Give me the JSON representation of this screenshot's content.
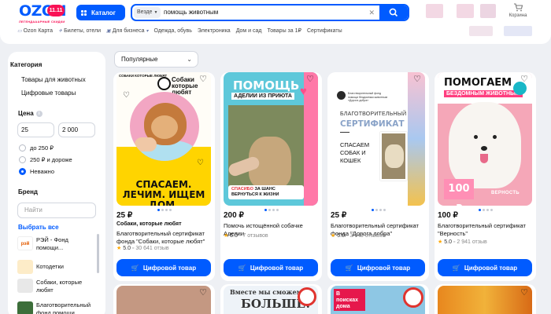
{
  "header": {
    "logo": "OZON",
    "logo_badge": "11.11",
    "logo_slogan": "ЛЕГЕНДАААРНЫЕ СКИДКИ",
    "catalog_label": "Каталог",
    "search_scope": "Везде",
    "search_value": "помощь животным",
    "cart_label": "Корзина",
    "icons": [
      "grid-icon",
      "search-icon",
      "clear-icon",
      "cart-icon"
    ],
    "subnav": [
      "Ozon Карта",
      "Билеты, отели",
      "Для бизнеса",
      "Одежда, обувь",
      "Электроника",
      "Дом и сад",
      "Товары за 1₽",
      "Сертификаты"
    ]
  },
  "sidebar": {
    "category_heading": "Категория",
    "categories": [
      "Товары для животных",
      "Цифровые товары"
    ],
    "price_heading": "Цена",
    "price_from": "25",
    "price_to": "2 000",
    "price_options": [
      "до 250 ₽",
      "250 ₽ и дороже",
      "Неважно"
    ],
    "price_selected": "Неважно",
    "brand_heading": "Бренд",
    "brand_placeholder": "Найти",
    "select_all": "Выбрать все",
    "brands": [
      {
        "name": "РЭЙ - Фонд помощи...",
        "logo": "рэй"
      },
      {
        "name": "Котодетки",
        "logo": ""
      },
      {
        "name": "Собаки, которые любят",
        "logo": ""
      },
      {
        "name": "Благотворительный фонд помощи",
        "logo": ""
      }
    ]
  },
  "sort": {
    "value": "Популярные"
  },
  "products": [
    {
      "price": "25 ₽",
      "seller": "Собаки, которые любят",
      "title": "Благотворительный сертификат фонда \"Собаки, которые любят\"",
      "rating": "5.0",
      "reviews": "30 641 отзыв",
      "button": "Цифровой товар",
      "image": {
        "logo_small": "СОБАКИ КОТОРЫЕ ЛЮБЯТ",
        "logo_right": "Собаки которые любят",
        "slogan": "СПАСАЕМ. ЛЕЧИМ. ИЩЕМ ДОМ."
      }
    },
    {
      "price": "200 ₽",
      "seller": "",
      "title": "Помочь истощённой собачке Аделии",
      "rating": "5.0",
      "reviews": "7 отзывов",
      "button": "Цифровой товар",
      "image": {
        "h1": "ПОМОЩЬ",
        "h2": "АДЕЛИИ ИЗ ПРИЮТА",
        "banner_strong": "СПАСИБО",
        "banner_rest": "ЗА ШАНС ВЕРНУТЬСЯ К ЖИЗНИ"
      }
    },
    {
      "price": "25 ₽",
      "seller": "",
      "title": "Благотворительный сертификат фонда \"Дорога добра\"",
      "rating": "5.0",
      "reviews": "3 649 отзывов",
      "button": "Цифровой товар",
      "image": {
        "logo_text": "Благотворительный фонд помощи бездомным животным «Дорога добра»",
        "cert_top": "БЛАГОТВОРИТЕЛЬНЫЙ",
        "cert": "СЕРТИФИКАТ",
        "save": "СПАСАЕМ СОБАК И КОШЕК"
      }
    },
    {
      "price": "100 ₽",
      "seller": "",
      "title": "Благотворительный сертификат \"Верность\"",
      "rating": "5.0",
      "reviews": "2 941 отзыв",
      "button": "Цифровой товар",
      "image": {
        "h1": "ПОМОГАЕМ",
        "h2": "БЕЗДОМНЫМ ЖИВОТНЫМ",
        "price_tag": "100 ₽",
        "brand": "ВЕРНОСТЬ"
      }
    }
  ],
  "bottom_row": [
    {
      "text1": "",
      "text2": ""
    },
    {
      "text1": "Вместе мы сможем",
      "text2": "БОЛЬШЕ!"
    },
    {
      "text1": "В поисках дома",
      "text2": ""
    },
    {
      "text1": "",
      "text2": ""
    }
  ],
  "colors": {
    "accent": "#005bff",
    "sale": "#f91155",
    "star": "#ffa800"
  }
}
